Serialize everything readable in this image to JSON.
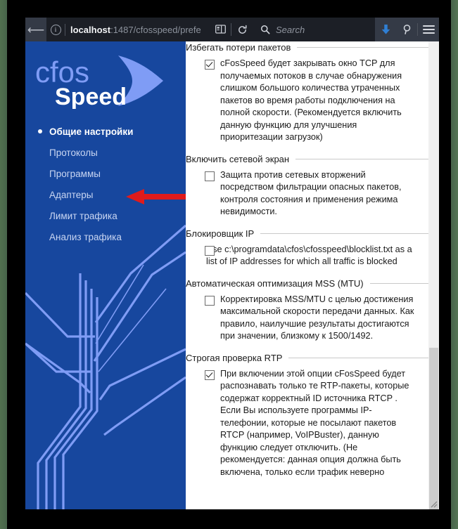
{
  "desktop": {
    "bg_color": "#4a6b4a",
    "frame_color": "#000000"
  },
  "browser": {
    "toolbar": {
      "back_icon": "back-arrow-icon",
      "info_icon": "info-circle-icon",
      "url_host": "localhost",
      "url_rest": ":1487/cfosspeed/prefe",
      "reader_icon": "reader-view-icon",
      "reload_icon": "reload-icon",
      "search_icon": "search-icon",
      "search_placeholder": "Search",
      "download_icon": "download-arrow-icon",
      "find_icon": "magnifier-icon",
      "menu_icon": "hamburger-menu-icon",
      "bg_color": "#343a46",
      "url_bg_color": "#1c1f26",
      "download_color": "#2f7fd4"
    }
  },
  "sidebar": {
    "bg_color": "#17479e",
    "logo": {
      "text_primary": "cfos",
      "text_secondary": "Speed",
      "primary_color": "#7f9cf5",
      "secondary_color": "#ffffff"
    },
    "items": [
      {
        "label": "Общие настройки",
        "active": true
      },
      {
        "label": "Протоколы",
        "active": false
      },
      {
        "label": "Программы",
        "active": false
      },
      {
        "label": "Адаптеры",
        "active": false
      },
      {
        "label": "Лимит трафика",
        "active": false
      },
      {
        "label": "Анализ трафика",
        "active": false
      }
    ]
  },
  "annotation": {
    "type": "arrow-left",
    "color": "#e01b1b",
    "points_to": "Протоколы"
  },
  "content": {
    "sections": [
      {
        "title": "Избегать потери пакетов",
        "options": [
          {
            "checked": true,
            "hanging": false,
            "text": "cFosSpeed будет закрывать окно TCP для получаемых потоков в случае обнаружения слишком большого количества утраченных пакетов во время работы подключения на полной скорости. (Рекомендуется включить данную функцию для улучшения приоритезации загрузок)"
          }
        ]
      },
      {
        "title": "Включить сетевой экран",
        "options": [
          {
            "checked": false,
            "hanging": false,
            "text": "Защита против сетевых вторжений посредством фильтрации опасных пакетов, контроля состояния и применения режима невидимости."
          }
        ]
      },
      {
        "title": "Блокировщик IP",
        "options": [
          {
            "checked": false,
            "hanging": true,
            "text": "Use c:\\programdata\\cfos\\cfosspeed\\blocklist.txt as a list of IP addresses for which all traffic is blocked"
          }
        ]
      },
      {
        "title": "Автоматическая оптимизация MSS (MTU)",
        "options": [
          {
            "checked": false,
            "hanging": false,
            "text": "Корректировка MSS/MTU с целью достижения максимальной скорости передачи данных. Как правило, наилучшие результаты достигаются при значении, близкому к 1500/1492."
          }
        ]
      },
      {
        "title": "Строгая проверка RTP",
        "options": [
          {
            "checked": true,
            "hanging": false,
            "text": "При включении этой опции cFosSpeed будет распознавать только те RTP-пакеты, которые содержат корректный ID источника RTCP . Если Вы используете программы IP-телефонии, которые не посылают пакетов RTCP (например, VoIPBuster), данную функцию следует отключить. (Не рекомендуется: данная опция должна быть включена, только если трафик неверно"
          }
        ]
      }
    ]
  },
  "scrollbar": {
    "track_color": "#f0f0f0",
    "thumb_color": "#cdcdcd"
  }
}
